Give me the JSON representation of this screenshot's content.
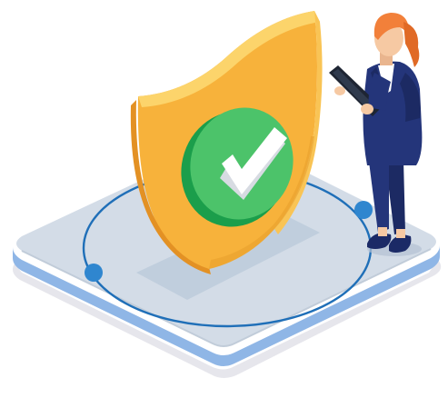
{
  "illustration": {
    "subject": "security-verification",
    "elements": [
      "platform",
      "orbit-ring",
      "shield",
      "checkmark",
      "business-woman",
      "tablet"
    ],
    "icons": {
      "shield": "shield-icon",
      "check": "checkmark-icon",
      "tablet": "tablet-icon"
    },
    "colors": {
      "background": "#ffffff",
      "platform_top": "#d3dce7",
      "platform_side": "#8fb6e6",
      "platform_base": "#e6e6ec",
      "ring": "#1f6fb8",
      "ring_node": "#2f86cf",
      "shield_face": "#f7b23b",
      "shield_side": "#f0a02a",
      "shield_rim": "#fcd46b",
      "check_circle": "#4cc36a",
      "check_circle_dark": "#1b9e4b",
      "check_mark": "#ffffff",
      "suit": "#24357a",
      "hair": "#f2803a",
      "skin": "#f6c9a3"
    }
  }
}
